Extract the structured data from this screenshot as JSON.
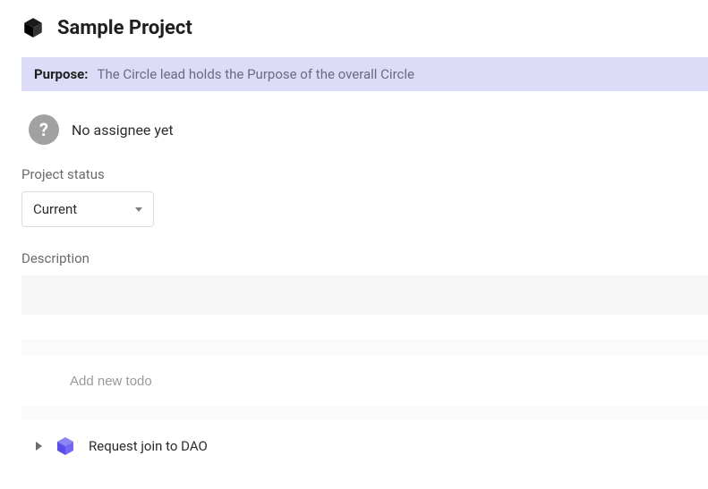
{
  "header": {
    "title": "Sample Project"
  },
  "purpose": {
    "label": "Purpose:",
    "text": "The Circle lead holds the Purpose of the overall Circle"
  },
  "assignee": {
    "text": "No assignee yet",
    "avatar_glyph": "?"
  },
  "status": {
    "label": "Project status",
    "selected": "Current"
  },
  "description": {
    "label": "Description",
    "value": ""
  },
  "add_todo": {
    "placeholder": "Add new todo"
  },
  "todos": [
    {
      "title": "Request join to DAO"
    }
  ],
  "colors": {
    "banner_bg": "#dcdcf8",
    "todo_icon": "#6a5cf0"
  }
}
